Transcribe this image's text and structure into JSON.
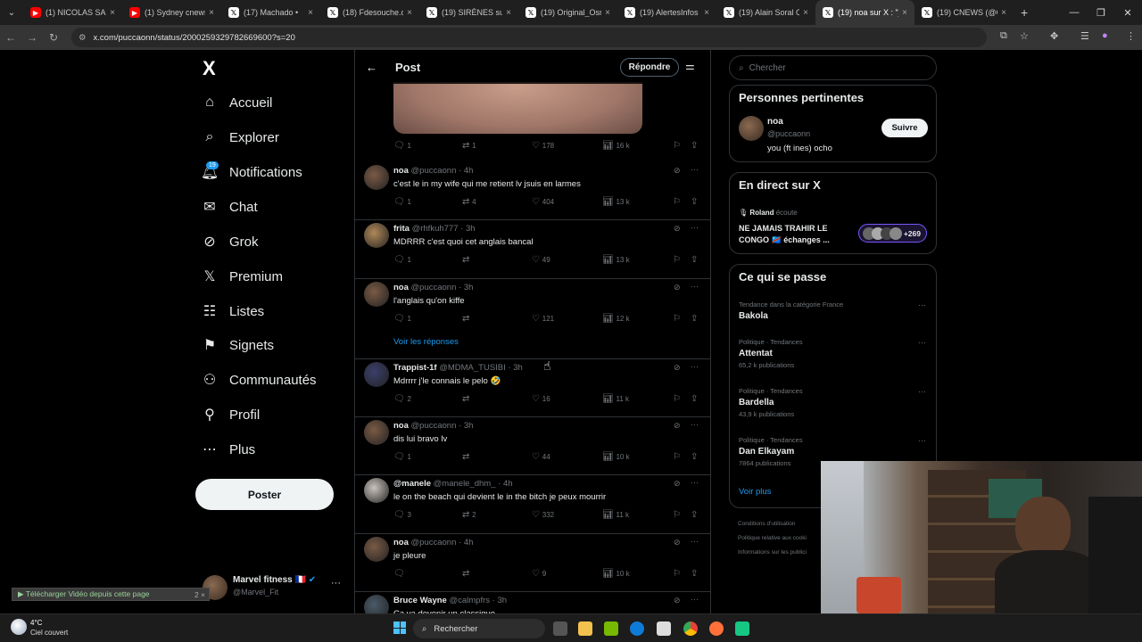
{
  "browser": {
    "tabs": [
      {
        "label": "(1) NICOLAS SARA",
        "icon": "youtube-icon"
      },
      {
        "label": "(1) Sydney cnews",
        "icon": "youtube-icon"
      },
      {
        "label": "(17) Machado •",
        "icon": "x-icon"
      },
      {
        "label": "(18) Fdesouche.co",
        "icon": "x-icon"
      },
      {
        "label": "(19) SIRÈNES sur",
        "icon": "x-icon"
      },
      {
        "label": "(19) Original_Osm",
        "icon": "x-icon"
      },
      {
        "label": "(19) AlertesInfos s",
        "icon": "x-icon"
      },
      {
        "label": "(19) Alain Soral O",
        "icon": "x-icon"
      },
      {
        "label": "(19) noa sur X : \"j",
        "icon": "x-icon",
        "active": true
      },
      {
        "label": "(19) CNEWS (@C",
        "icon": "x-icon"
      }
    ],
    "url": "x.com/puccaonn/status/2000259329782669600?s=20"
  },
  "nav": {
    "logo": "X",
    "items": [
      {
        "label": "Accueil",
        "icon": "home-icon"
      },
      {
        "label": "Explorer",
        "icon": "search-icon"
      },
      {
        "label": "Notifications",
        "icon": "bell-icon",
        "badge": "19"
      },
      {
        "label": "Chat",
        "icon": "mail-icon"
      },
      {
        "label": "Grok",
        "icon": "grok-icon"
      },
      {
        "label": "Premium",
        "icon": "x-icon"
      },
      {
        "label": "Listes",
        "icon": "list-icon"
      },
      {
        "label": "Signets",
        "icon": "bookmark-icon"
      },
      {
        "label": "Communautés",
        "icon": "people-icon"
      },
      {
        "label": "Profil",
        "icon": "person-icon"
      },
      {
        "label": "Plus",
        "icon": "more-circle-icon"
      }
    ],
    "post_button": "Poster",
    "account": {
      "name": "Marvel fitness 🇫🇷",
      "handle": "@Marvel_Fit"
    }
  },
  "header": {
    "title": "Post",
    "reply_button": "Répondre"
  },
  "top_post_stats": {
    "replies": "1",
    "reposts": "1",
    "likes": "178",
    "views": "16 k"
  },
  "replies": [
    {
      "name": "noa",
      "handle": "@puccaonn",
      "time": "4h",
      "text": "c'est le in my wife qui me retient lv jsuis en larmes",
      "stats": {
        "replies": "1",
        "reposts": "4",
        "likes": "404",
        "views": "13 k"
      }
    },
    {
      "name": "frita",
      "handle": "@rhfkuh777",
      "time": "3h",
      "text": "MDRRR c'est quoi cet anglais bancal",
      "stats": {
        "replies": "1",
        "reposts": "",
        "likes": "49",
        "views": "13 k"
      }
    },
    {
      "name": "noa",
      "handle": "@puccaonn",
      "time": "3h",
      "text": "l'anglais qu'on kiffe",
      "stats": {
        "replies": "1",
        "reposts": "",
        "likes": "121",
        "views": "12 k"
      }
    },
    {
      "name": "Trappist-1f",
      "handle": "@MDMA_TUSIBI",
      "time": "3h",
      "text": "Mdrrrr j'le connais le pelo 🤣",
      "stats": {
        "replies": "2",
        "reposts": "",
        "likes": "16",
        "views": "11 k"
      }
    },
    {
      "name": "noa",
      "handle": "@puccaonn",
      "time": "3h",
      "text": "dis lui bravo lv",
      "stats": {
        "replies": "1",
        "reposts": "",
        "likes": "44",
        "views": "10 k"
      }
    },
    {
      "name": "@manele",
      "handle": "@manele_dhm_",
      "time": "4h",
      "text": "le on the beach qui devient le in the bitch je peux mourrir",
      "stats": {
        "replies": "3",
        "reposts": "2",
        "likes": "332",
        "views": "11 k"
      }
    },
    {
      "name": "noa",
      "handle": "@puccaonn",
      "time": "4h",
      "text": "je pleure",
      "stats": {
        "replies": "",
        "reposts": "",
        "likes": "9",
        "views": "10 k"
      }
    },
    {
      "name": "Bruce Wayne",
      "handle": "@calmpfrs",
      "time": "3h",
      "text": "Ça va devenir un classique",
      "stats": {
        "replies": "",
        "reposts": "",
        "likes": "",
        "views": ""
      }
    }
  ],
  "see_replies": "Voir les réponses",
  "right": {
    "search_placeholder": "Chercher",
    "relevant": {
      "title": "Personnes pertinentes",
      "name": "noa",
      "handle": "@puccaonn",
      "bio": "you (ft ines) ocho",
      "follow": "Suivre"
    },
    "live": {
      "title": "En direct sur X",
      "host": "Roland",
      "action": "écoute",
      "text": "NE JAMAIS TRAHIR LE CONGO 🇨🇩 échanges ...",
      "count": "+269"
    },
    "happening": {
      "title": "Ce qui se passe",
      "trends": [
        {
          "category": "Tendance dans la catégorie France",
          "name": "Bakola",
          "count": ""
        },
        {
          "category": "Politique · Tendances",
          "name": "Attentat",
          "count": "65,2 k publications"
        },
        {
          "category": "Politique · Tendances",
          "name": "Bardella",
          "count": "43,9 k publications"
        },
        {
          "category": "Politique · Tendances",
          "name": "Dan Elkayam",
          "count": "7864 publications"
        }
      ],
      "more": "Voir plus"
    },
    "footer": [
      "Conditions d'utilisation",
      "Politique relative aux cooki",
      "Informations sur les publici"
    ]
  },
  "download_bar": "▶ Télécharger Vidéo depuis cette page",
  "taskbar": {
    "weather_temp": "4°C",
    "weather_desc": "Ciel couvert",
    "search": "Rechercher"
  }
}
